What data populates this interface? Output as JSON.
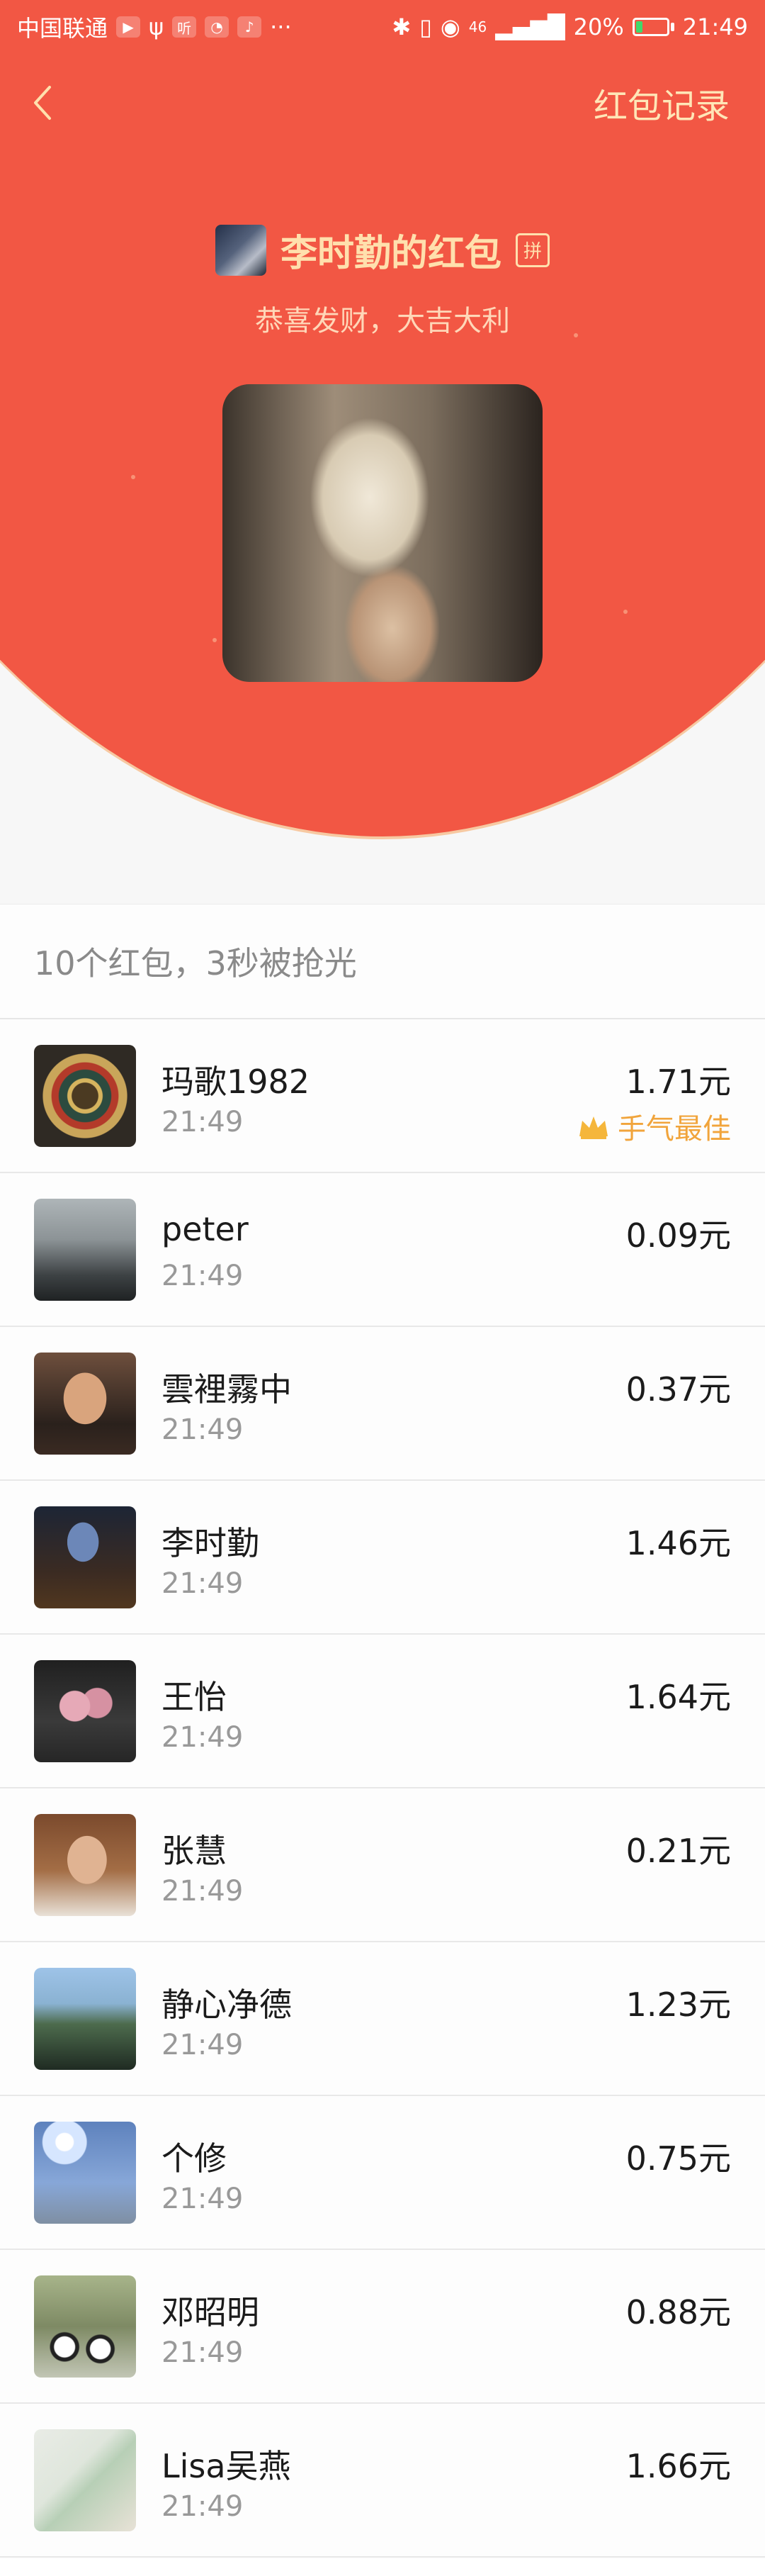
{
  "status_bar": {
    "carrier": "中国联通",
    "network": "46",
    "battery": "20%",
    "battery_level": 0.2,
    "time": "21:49"
  },
  "nav": {
    "records_label": "红包记录"
  },
  "sender": {
    "name": "李时勤的红包",
    "pin_label": "拼",
    "greeting": "恭喜发财，大吉大利"
  },
  "summary": "10个红包，3秒被抢光",
  "best_label": "手气最佳",
  "colors": {
    "header_red": "#f25744",
    "gold_text": "#ffe0ad",
    "best_badge": "#f1a43b"
  },
  "records": [
    {
      "name": "玛歌1982",
      "time": "21:49",
      "amount": "1.71元",
      "best": true
    },
    {
      "name": "peter",
      "time": "21:49",
      "amount": "0.09元"
    },
    {
      "name": "雲裡霧中",
      "time": "21:49",
      "amount": "0.37元"
    },
    {
      "name": "李时勤",
      "time": "21:49",
      "amount": "1.46元"
    },
    {
      "name": "王怡",
      "time": "21:49",
      "amount": "1.64元"
    },
    {
      "name": "张慧",
      "time": "21:49",
      "amount": "0.21元"
    },
    {
      "name": "静心净德",
      "time": "21:49",
      "amount": "1.23元"
    },
    {
      "name": "个修",
      "time": "21:49",
      "amount": "0.75元"
    },
    {
      "name": "邓昭明",
      "time": "21:49",
      "amount": "0.88元"
    },
    {
      "name": "Lisa吴燕",
      "time": "21:49",
      "amount": "1.66元"
    }
  ]
}
